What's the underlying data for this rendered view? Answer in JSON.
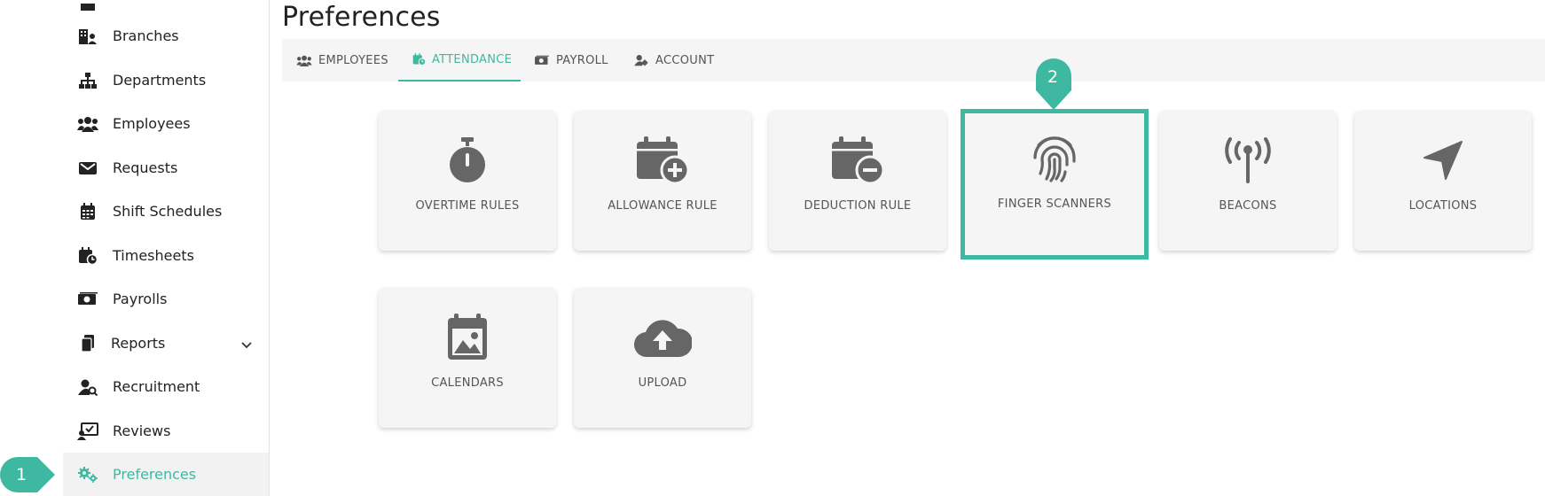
{
  "sidebar": {
    "items": [
      {
        "label": "Branches",
        "icon": "branches-icon"
      },
      {
        "label": "Departments",
        "icon": "departments-icon"
      },
      {
        "label": "Employees",
        "icon": "employees-icon"
      },
      {
        "label": "Requests",
        "icon": "requests-icon"
      },
      {
        "label": "Shift Schedules",
        "icon": "calendar-icon"
      },
      {
        "label": "Timesheets",
        "icon": "timesheets-icon"
      },
      {
        "label": "Payrolls",
        "icon": "money-icon"
      },
      {
        "label": "Reports",
        "icon": "document-icon"
      },
      {
        "label": "Recruitment",
        "icon": "user-search-icon"
      },
      {
        "label": "Reviews",
        "icon": "review-icon"
      },
      {
        "label": "Preferences",
        "icon": "gears-icon",
        "active": true
      }
    ]
  },
  "markers": {
    "step1": "1",
    "step2": "2"
  },
  "page": {
    "title": "Preferences"
  },
  "tabs": [
    {
      "label": "EMPLOYEES"
    },
    {
      "label": "ATTENDANCE",
      "active": true
    },
    {
      "label": "PAYROLL"
    },
    {
      "label": "ACCOUNT"
    }
  ],
  "cards": [
    {
      "label": "OVERTIME RULES",
      "icon": "stopwatch-icon"
    },
    {
      "label": "ALLOWANCE RULE",
      "icon": "calendar-plus-icon"
    },
    {
      "label": "DEDUCTION RULE",
      "icon": "calendar-minus-icon"
    },
    {
      "label": "FINGER SCANNERS",
      "icon": "fingerprint-icon",
      "highlighted": true
    },
    {
      "label": "BEACONS",
      "icon": "antenna-icon"
    },
    {
      "label": "LOCATIONS",
      "icon": "location-arrow-icon"
    },
    {
      "label": "CALENDARS",
      "icon": "calendar-image-icon"
    },
    {
      "label": "UPLOAD",
      "icon": "cloud-upload-icon"
    }
  ],
  "colors": {
    "accent": "#3eb8a0",
    "icon_gray": "#666666",
    "card_bg": "#f5f5f5"
  }
}
